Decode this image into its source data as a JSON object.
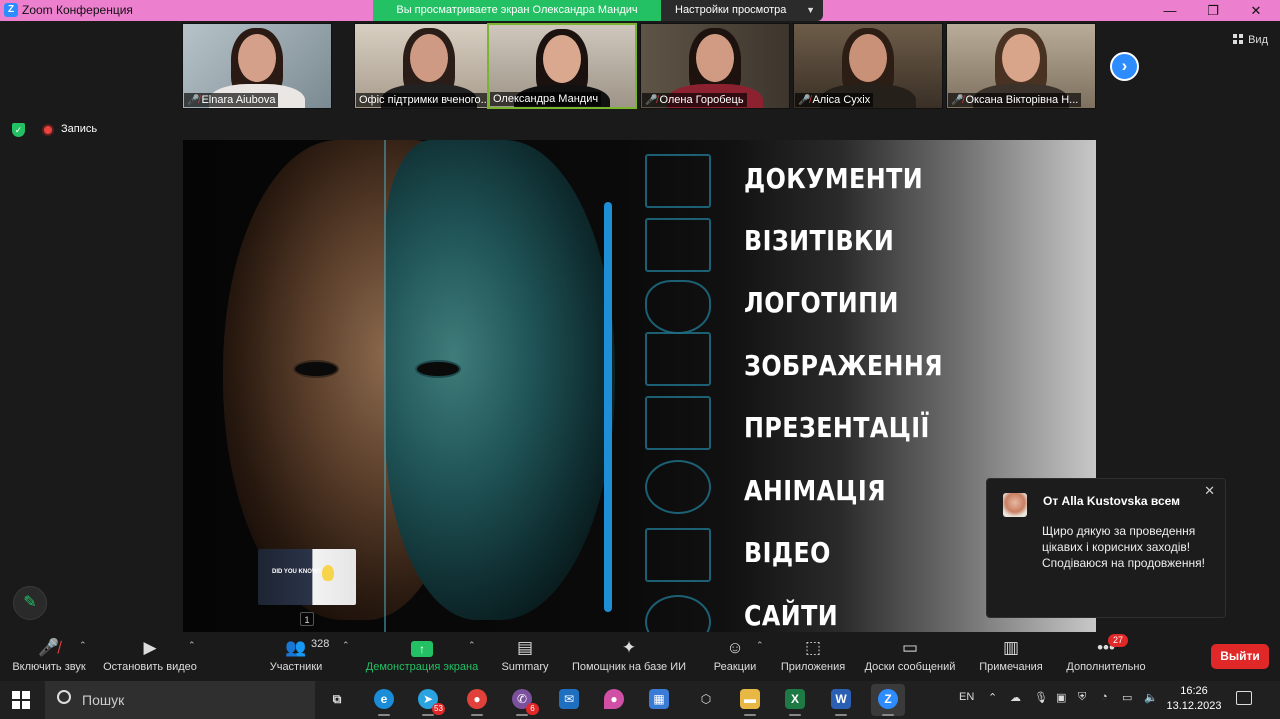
{
  "window": {
    "app_title": "Zoom Конференция",
    "share_banner": "Вы просматриваете экран Олександра Мандич",
    "view_settings": "Настройки просмотра",
    "view_label": "Вид",
    "accent_color": "#ed7fcf",
    "share_color": "#23c064"
  },
  "recording": {
    "label": "Запись"
  },
  "participants": [
    {
      "name": "Elnara Aiubova",
      "muted": true
    },
    {
      "name": "Офіс підтримки вченого...",
      "muted": false
    },
    {
      "name": "Олександра Мандич",
      "muted": false,
      "active": true
    },
    {
      "name": "Олена Горобець",
      "muted": true
    },
    {
      "name": "Аліса Сухіх",
      "muted": true
    },
    {
      "name": "Оксана Вікторівна Н...",
      "muted": true
    }
  ],
  "slide": {
    "items": [
      "ДОКУМЕНТИ",
      "ВІЗИТІВКИ",
      "ЛОГОТИПИ",
      "ЗОБРАЖЕННЯ",
      "ПРЕЗЕНТАЦІЇ",
      "АНІМАЦІЯ",
      "ВІДЕО",
      "САЙТИ"
    ],
    "card_text": "DID YOU KNOW?",
    "page_number": "1"
  },
  "chat": {
    "from": "От Alla Kustovska всем",
    "message": "Щиро дякую за проведення цікавих і корисних заходів! Сподіваюся на продовження!"
  },
  "controls": {
    "unmute": "Включить звук",
    "stop_video": "Остановить видео",
    "participants": "Участники",
    "participants_count": "328",
    "share": "Демонстрация экрана",
    "summary": "Summary",
    "ai_assistant": "Помощник на базе ИИ",
    "reactions": "Реакции",
    "apps": "Приложения",
    "whiteboards": "Доски сообщений",
    "notes": "Примечания",
    "more": "Дополнительно",
    "more_badge": "27",
    "leave": "Выйти"
  },
  "taskbar": {
    "search_placeholder": "Пошук",
    "telegram_badge": "53",
    "viber_badge": "6",
    "language": "EN",
    "time": "16:26",
    "date": "13.12.2023"
  }
}
